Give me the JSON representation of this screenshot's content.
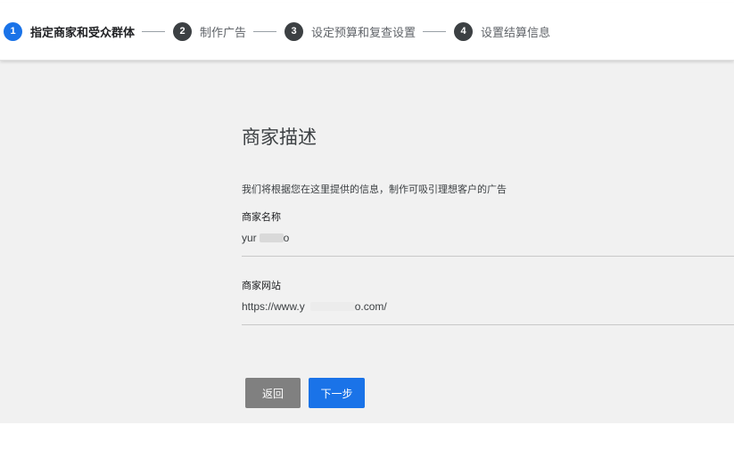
{
  "stepper": {
    "steps": [
      {
        "number": "1",
        "label": "指定商家和受众群体",
        "state": "active",
        "color": "#1a73e8"
      },
      {
        "number": "2",
        "label": "制作广告",
        "state": "inactive",
        "color": "#3c4043"
      },
      {
        "number": "3",
        "label": "设定预算和复查设置",
        "state": "inactive",
        "color": "#3c4043"
      },
      {
        "number": "4",
        "label": "设置结算信息",
        "state": "inactive",
        "color": "#3c4043"
      }
    ]
  },
  "section": {
    "title": "商家描述",
    "description": "我们将根据您在这里提供的信息，制作可吸引理想客户的广告"
  },
  "fields": {
    "business_name": {
      "label": "商家名称",
      "value_start": "yur",
      "value_end": "o"
    },
    "business_website": {
      "label": "商家网站",
      "value_start": "https://www.y",
      "value_end": "o.com/"
    }
  },
  "actions": {
    "back_label": "返回",
    "next_label": "下一步"
  },
  "colors": {
    "primary": "#1a73e8",
    "secondary_button": "#808080",
    "content_background": "#f1f1f1"
  }
}
